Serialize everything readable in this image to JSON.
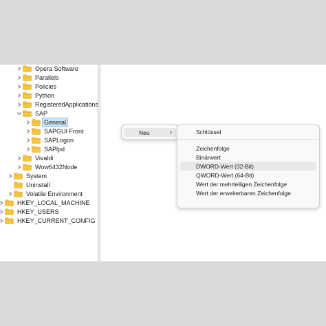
{
  "tree": [
    {
      "label": "Opera Software",
      "chevron": "right"
    },
    {
      "label": "Parallels",
      "chevron": "right"
    },
    {
      "label": "Policies",
      "chevron": "right"
    },
    {
      "label": "Python",
      "chevron": "right"
    },
    {
      "label": "RegisteredApplications",
      "chevron": "right"
    },
    {
      "label": "SAP",
      "chevron": "down"
    },
    {
      "label": "General",
      "chevron": "right",
      "selected": true
    },
    {
      "label": "SAPGUI Front",
      "chevron": "right"
    },
    {
      "label": "SAPLogon",
      "chevron": "right"
    },
    {
      "label": "SAPlpd",
      "chevron": "right"
    },
    {
      "label": "Vivaldi",
      "chevron": "right"
    },
    {
      "label": "Wow6432Node",
      "chevron": "right"
    },
    {
      "label": "System",
      "chevron": "right"
    },
    {
      "label": "Uninstall",
      "chevron": "none"
    },
    {
      "label": "Volatile Environment",
      "chevron": "right"
    },
    {
      "label": "HKEY_LOCAL_MACHINE",
      "chevron": "right"
    },
    {
      "label": "HKEY_USERS",
      "chevron": "right"
    },
    {
      "label": "HKEY_CURRENT_CONFIG",
      "chevron": "right"
    }
  ],
  "context_menu": {
    "item": "Neu",
    "arrow": "›"
  },
  "submenu": {
    "items": [
      "Schlüssel",
      "Zeichenfolge",
      "Binärwert",
      "DWORD-Wert (32-Bit)",
      "QWORD-Wert (64-Bit)",
      "Wert der mehrteiligen Zeichenfolge",
      "Wert der erweiterbaren Zeichenfolge"
    ],
    "highlighted": "DWORD-Wert (32-Bit)"
  },
  "colors": {
    "folder": "#f5c542",
    "folder_dark": "#e0a82e",
    "selection": "#cce4f7"
  }
}
